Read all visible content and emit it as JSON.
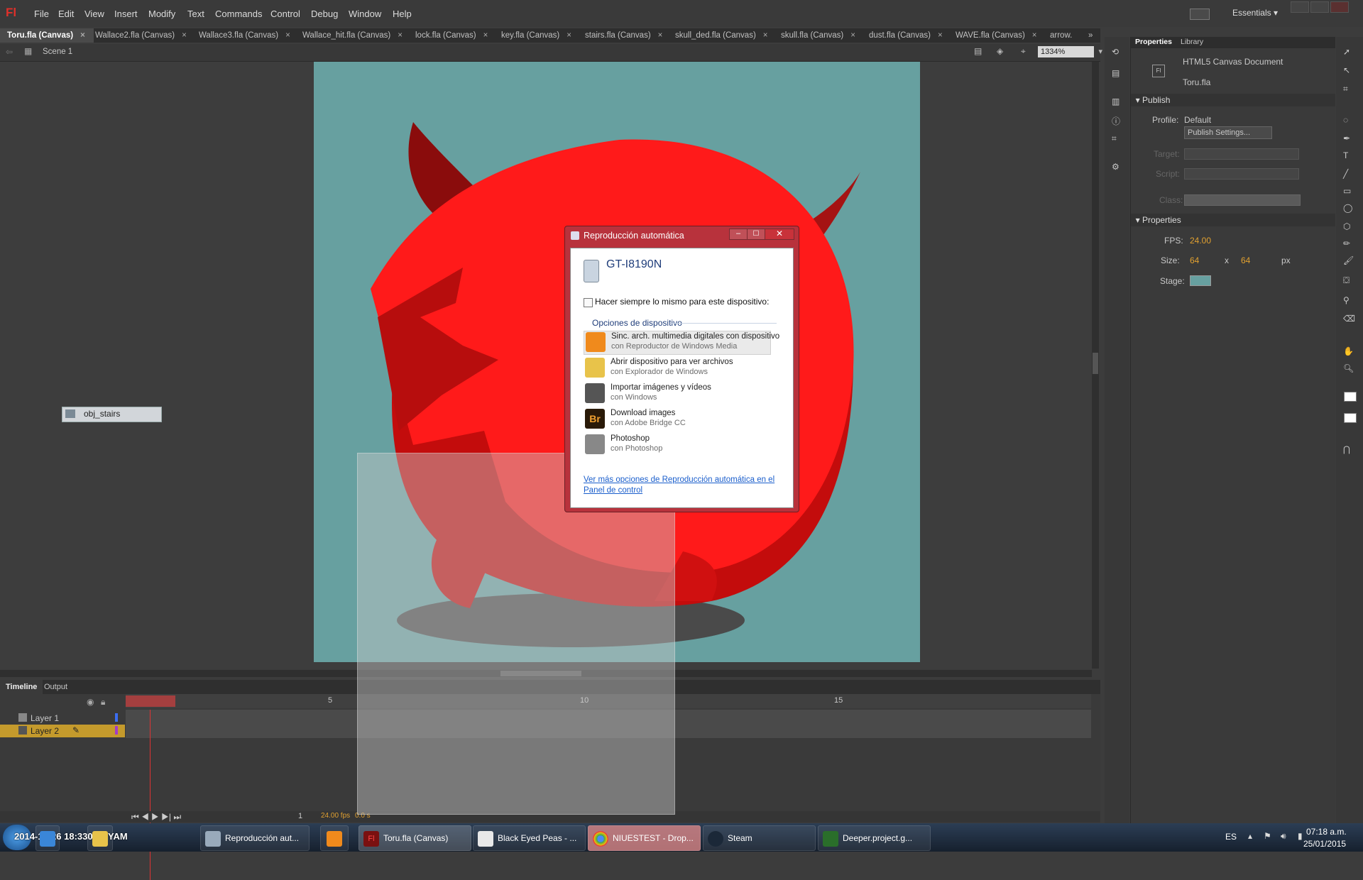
{
  "app": {
    "logo": "Fl",
    "workspace": "Essentials"
  },
  "menu": [
    "File",
    "Edit",
    "View",
    "Insert",
    "Modify",
    "Text",
    "Commands",
    "Control",
    "Debug",
    "Window",
    "Help"
  ],
  "doc_tabs": [
    "Toru.fla (Canvas)",
    "Wallace2.fla (Canvas)",
    "Wallace3.fla (Canvas)",
    "Wallace_hit.fla (Canvas)",
    "lock.fla (Canvas)",
    "key.fla (Canvas)",
    "stairs.fla (Canvas)",
    "skull_ded.fla (Canvas)",
    "skull.fla (Canvas)",
    "dust.fla (Canvas)",
    "WAVE.fla (Canvas)",
    "arrow."
  ],
  "scene": {
    "label": "Scene 1",
    "zoom": "1334%"
  },
  "stage": {
    "color": "#67a0a0",
    "object_label": "obj_stairs"
  },
  "timeline": {
    "tabs": [
      "Timeline",
      "Output"
    ],
    "ruler": [
      "5",
      "10",
      "15"
    ],
    "layers": [
      "Layer 1",
      "Layer 2"
    ],
    "current_frame": "1",
    "fps": "24.00 fps",
    "time": "0.0 s"
  },
  "properties": {
    "tabs": [
      "Properties",
      "Library"
    ],
    "doc_type": "HTML5 Canvas Document",
    "doc_name": "Toru.fla",
    "publish_header": "Publish",
    "profile_label": "Profile:",
    "profile_value": "Default",
    "publish_settings": "Publish Settings...",
    "target_label": "Target:",
    "script_label": "Script:",
    "class_label": "Class:",
    "props_header": "Properties",
    "fps_label": "FPS:",
    "fps_value": "24.00",
    "size_label": "Size:",
    "width": "64",
    "x": "x",
    "height": "64",
    "unit": "px",
    "stage_label": "Stage:"
  },
  "dialog": {
    "title": "Reproducción automática",
    "device": "GT-I8190N",
    "checkbox": "Hacer siempre lo mismo para este dispositivo:",
    "group": "Opciones de dispositivo",
    "items": [
      {
        "t1": "Sinc. arch. multimedia digitales con dispositivo",
        "t2": "con Reproductor de Windows Media",
        "icon": "media-player-icon",
        "color": "#f08a1c"
      },
      {
        "t1": "Abrir dispositivo para ver archivos",
        "t2": "con Explorador de Windows",
        "icon": "folder-icon",
        "color": "#e8c34a"
      },
      {
        "t1": "Importar imágenes y vídeos",
        "t2": "con Windows",
        "icon": "camera-icon",
        "color": "#555555"
      },
      {
        "t1": "Download images",
        "t2": "con Adobe Bridge CC",
        "icon": "bridge-icon",
        "color": "#2a1a08"
      },
      {
        "t1": "Photoshop",
        "t2": "con Photoshop",
        "icon": "scanner-icon",
        "color": "#888888"
      }
    ],
    "bridge_glyph": "Br",
    "link": "Ver más opciones de Reproducción automática en el Panel de control"
  },
  "taskbar": {
    "overlay_text": "2014-10-26 18:330.68 YAM",
    "buttons": [
      {
        "label": "",
        "icon": "explorer-icon"
      },
      {
        "label": "Reproducción aut...",
        "icon": "phone-icon"
      },
      {
        "label": "",
        "icon": "media-player-icon"
      },
      {
        "label": "Toru.fla (Canvas)",
        "icon": "flash-icon"
      },
      {
        "label": "Black Eyed Peas - ...",
        "icon": "music-icon"
      },
      {
        "label": "NIUESTEST - Drop...",
        "icon": "chrome-icon"
      },
      {
        "label": "Steam",
        "icon": "steam-icon"
      },
      {
        "label": "Deeper.project.g...",
        "icon": "gm-icon"
      }
    ],
    "lang": "ES",
    "time": "07:18 a.m.",
    "date": "25/01/2015"
  }
}
